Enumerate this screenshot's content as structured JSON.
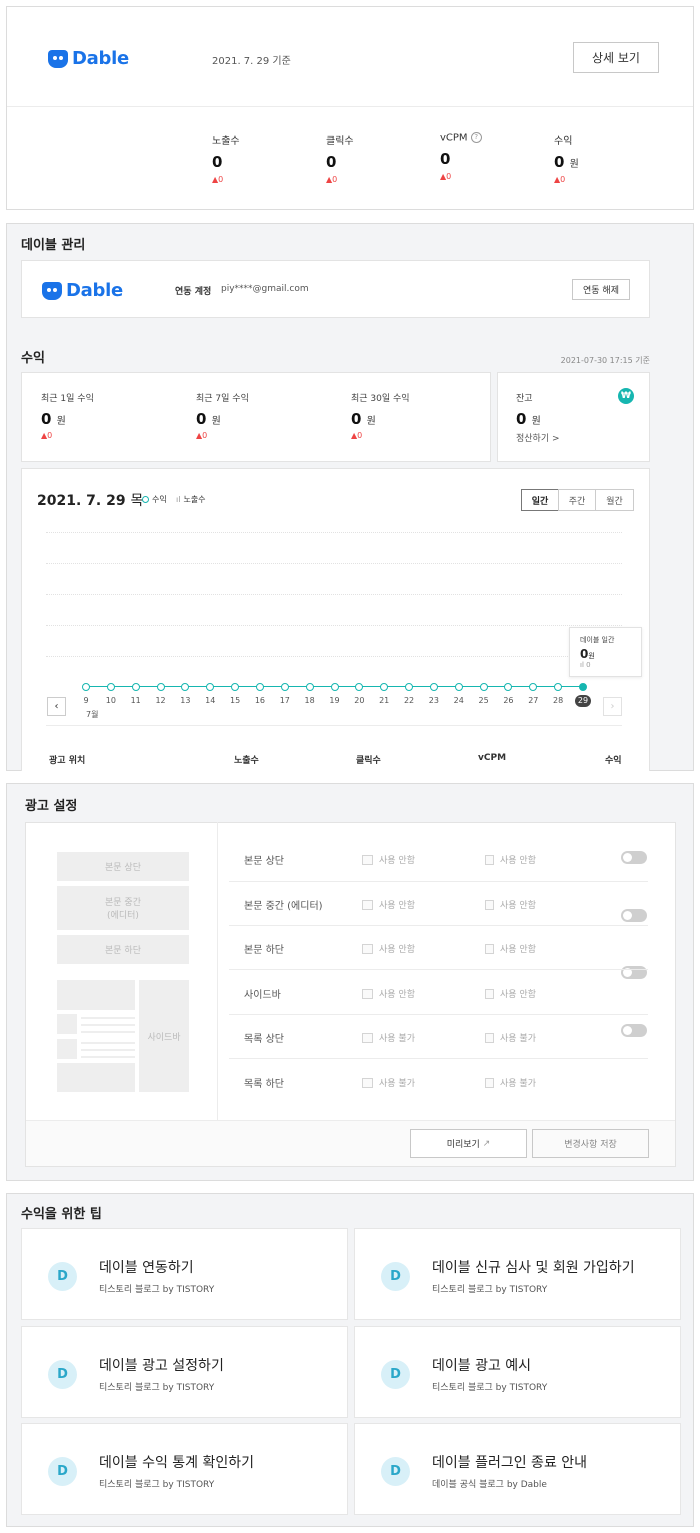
{
  "summary": {
    "logo": "Dable",
    "date": "2021. 7. 29 기준",
    "detail_button": "상세 보기",
    "stats": [
      {
        "label": "노출수",
        "value": "0",
        "unit": "",
        "delta": "▲0"
      },
      {
        "label": "클릭수",
        "value": "0",
        "unit": "",
        "delta": "▲0"
      },
      {
        "label": "vCPM",
        "value": "0",
        "unit": "",
        "delta": "▲0"
      },
      {
        "label": "수익",
        "value": "0",
        "unit": "원",
        "delta": "▲0"
      }
    ]
  },
  "manage": {
    "title": "데이블 관리",
    "logo": "Dable",
    "account_label": "연동 계정",
    "account_value": "piy****@gmail.com",
    "unlink_button": "연동 해제",
    "revenue_title": "수익",
    "revenue_time": "2021-07-30 17:15 기준",
    "revenue_cards": [
      {
        "label": "최근 1일 수익",
        "value": "0",
        "unit": "원",
        "delta": "▲0"
      },
      {
        "label": "최근 7일 수익",
        "value": "0",
        "unit": "원",
        "delta": "▲0"
      },
      {
        "label": "최근 30일 수익",
        "value": "0",
        "unit": "원",
        "delta": "▲0"
      }
    ],
    "balance": {
      "label": "잔고",
      "value": "0",
      "unit": "원",
      "link": "정산하기 >",
      "icon": "won-icon",
      "icon_glyph": "₩"
    },
    "chart_header": {
      "date": "2021. 7. 29",
      "weekday": "목",
      "legend_revenue": "수익",
      "legend_impressions": "노출수",
      "tabs": [
        "일간",
        "주간",
        "월간"
      ]
    },
    "tooltip": {
      "title": "데이블 일간",
      "value": "0",
      "unit": "원",
      "impressions": "0"
    },
    "table_headers": [
      "광고 위치",
      "노출수",
      "클릭수",
      "vCPM",
      "수익"
    ],
    "month_label": "7월"
  },
  "chart_data": {
    "type": "line",
    "x": [
      "9",
      "10",
      "11",
      "12",
      "13",
      "14",
      "15",
      "16",
      "17",
      "18",
      "19",
      "20",
      "21",
      "22",
      "23",
      "24",
      "25",
      "26",
      "27",
      "28",
      "29"
    ],
    "series": [
      {
        "name": "수익",
        "values": [
          0,
          0,
          0,
          0,
          0,
          0,
          0,
          0,
          0,
          0,
          0,
          0,
          0,
          0,
          0,
          0,
          0,
          0,
          0,
          0,
          0
        ]
      }
    ],
    "selected": "29"
  },
  "ad_settings": {
    "title": "광고 설정",
    "preview_blocks": [
      "본문 상단",
      "본문 중간\n(에디터)",
      "본문 하단",
      "사이드바"
    ],
    "rows": [
      {
        "label": "본문 상단",
        "opt1": "사용 안함",
        "opt2": "사용 안함",
        "toggle": true
      },
      {
        "label": "본문 중간 (에디터)",
        "opt1": "사용 안함",
        "opt2": "사용 안함",
        "toggle": true
      },
      {
        "label": "본문 하단",
        "opt1": "사용 안함",
        "opt2": "사용 안함",
        "toggle": true
      },
      {
        "label": "사이드바",
        "opt1": "사용 안함",
        "opt2": "사용 안함",
        "toggle": true
      },
      {
        "label": "목록 상단",
        "opt1": "사용 불가",
        "opt2": "사용 불가",
        "toggle": false
      },
      {
        "label": "목록 하단",
        "opt1": "사용 불가",
        "opt2": "사용 불가",
        "toggle": false
      }
    ],
    "preview_button": "미리보기",
    "save_button": "변경사항 저장"
  },
  "tips": {
    "title": "수익을 위한 팁",
    "items": [
      {
        "icon": "D",
        "title": "데이블 연동하기",
        "sub": "티스토리 블로그 by TISTORY"
      },
      {
        "icon": "D",
        "title": "데이블 신규 심사 및 회원 가입하기",
        "sub": "티스토리 블로그 by TISTORY"
      },
      {
        "icon": "D",
        "title": "데이블 광고 설정하기",
        "sub": "티스토리 블로그 by TISTORY"
      },
      {
        "icon": "D",
        "title": "데이블 광고 예시",
        "sub": "티스토리 블로그 by TISTORY"
      },
      {
        "icon": "D",
        "title": "데이블 수익 통계 확인하기",
        "sub": "티스토리 블로그 by TISTORY"
      },
      {
        "icon": "D",
        "title": "데이블 플러그인 종료 안내",
        "sub": "데이블 공식 블로그 by Dable"
      }
    ]
  }
}
